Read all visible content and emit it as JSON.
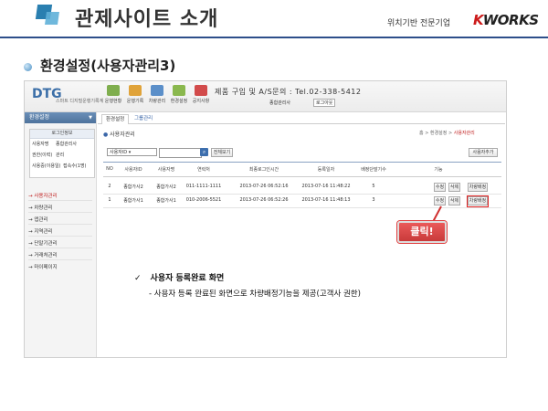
{
  "slide": {
    "title": "관제사이트 소개",
    "subtitle": "위치기반 전문기업",
    "logo_k": "K",
    "logo_rest": "WORKS",
    "section_title": "환경설정(사용자관리3)"
  },
  "app": {
    "logo": "DTG",
    "logo_sub": "스마트 디지털운행기록계",
    "toolbar": [
      "운행현황",
      "운행기록",
      "차량관리",
      "환경설정",
      "공지사항"
    ],
    "contact": "제품 구입 및 A/S문의 : Tel.02-338-5412",
    "user_info": "종합관리사",
    "logout": "로그아웃"
  },
  "sidebar": {
    "header": "환경설정",
    "header_arrow": "▼",
    "login_title": "로그인정보",
    "login_rows": [
      {
        "k": "사용자명",
        "v": "종합관리사"
      },
      {
        "k": "권한(이력)",
        "v": "관리"
      },
      {
        "k": "사용중(이용일)",
        "v": "접속수(1명)"
      }
    ],
    "menu": [
      "사용자관리",
      "차량관리",
      "앱관리",
      "지역관리",
      "단말기관리",
      "거래처관리",
      "마이페이지"
    ]
  },
  "main": {
    "tabs": [
      "환경설정",
      "그룹관리"
    ],
    "page_title": "사용자관리",
    "breadcrumb_prefix": "홈 > 환경설정 > ",
    "breadcrumb_current": "사용자관리",
    "select_value": "사용자ID",
    "search_icon": "search-icon",
    "search_btn": "전체보기",
    "add_btn": "사용자추가",
    "columns": [
      "NO",
      "사용자ID",
      "사용자명",
      "연락처",
      "최종로그인시간",
      "등록일자",
      "배정단말기수",
      "기능"
    ],
    "rows": [
      {
        "no": "2",
        "id": "종합가사2",
        "name": "종합가사2",
        "phone": "011-1111-1111",
        "last": "2013-07-26 06:52:16",
        "reg": "2013-07-16 11:48:22",
        "count": "5",
        "btns": [
          "수정",
          "삭제",
          "차량배정"
        ]
      },
      {
        "no": "1",
        "id": "종합가사1",
        "name": "종합가사1",
        "phone": "010-2006-5521",
        "last": "2013-07-26 06:52:26",
        "reg": "2013-07-16 11:48:13",
        "count": "3",
        "btns": [
          "수정",
          "삭제",
          "차량배정"
        ]
      }
    ]
  },
  "callout": "클릭!",
  "notes": {
    "check": "✓",
    "title": "사용자 등록완료 화면",
    "desc": "- 사용자 등록 완료된 화면으로 차량배정기능을 제공(고객사 권한)"
  }
}
